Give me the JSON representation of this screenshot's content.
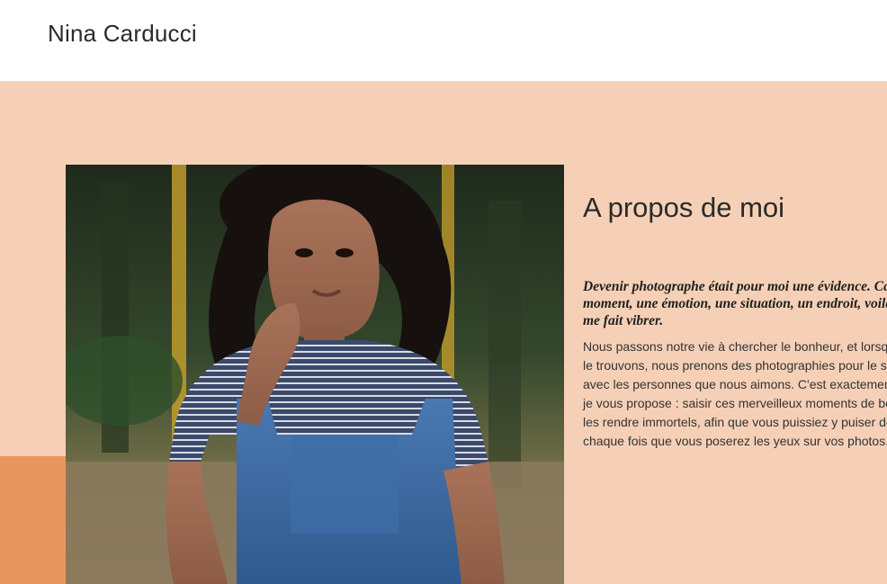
{
  "header": {
    "site_title": "Nina Carducci"
  },
  "about": {
    "photo_alt": "Portrait de Nina Carducci",
    "title": "A propos de moi",
    "lead": "Devenir photographe était pour moi une évidence. Capturer un moment, une émotion, une situation, un endroit, voilà tout ce qui me fait vibrer.",
    "body": "Nous passons notre vie à chercher le bonheur, et lorsque nous le trouvons, nous prenons des photographies pour le savourer avec les personnes que nous aimons. C'est exactement ce que je vous propose : saisir ces merveilleux moments de bonheur et les rendre immortels, afin que vous puissiez y puiser de l'amour chaque fois que vous poserez les yeux sur vos photos."
  },
  "colors": {
    "section_background": "#f6d0b6",
    "accent": "#e9965e",
    "text": "#2a2a2a"
  }
}
